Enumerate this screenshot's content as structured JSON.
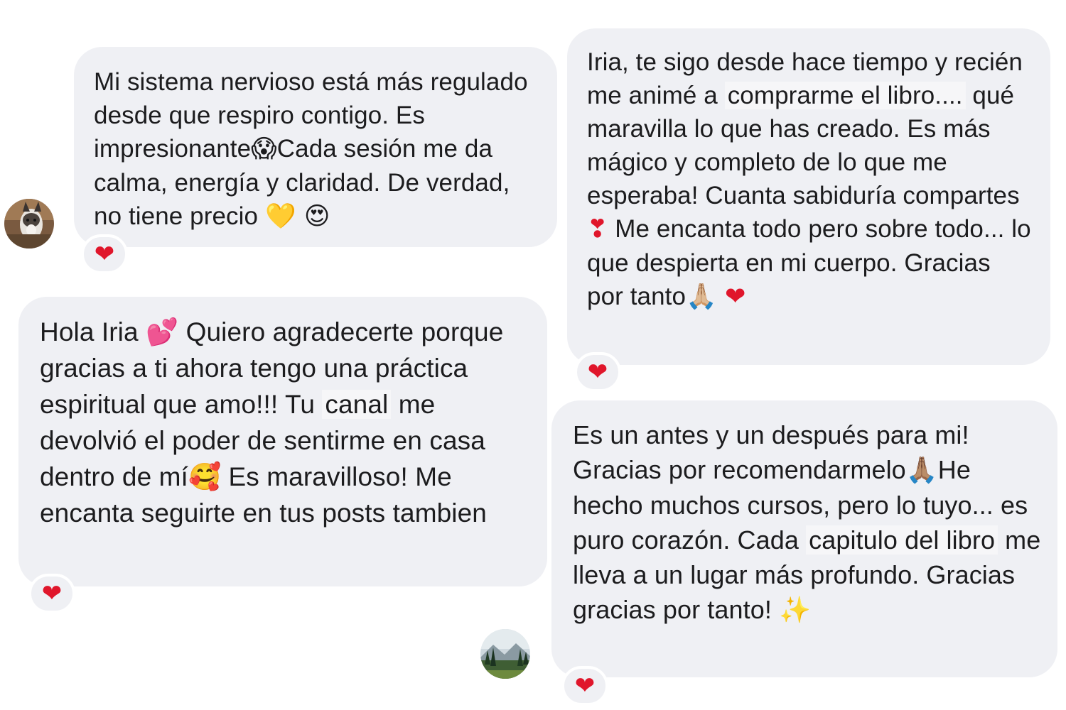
{
  "messages": [
    {
      "text_before": "Mi sistema nervioso está más regulado desde que respiro contigo. Es impresionante",
      "emoji_1": "😱",
      "text_after": "Cada sesión me da calma, energía y claridad. De verdad, no tiene precio ",
      "emoji_2": "💛 😍",
      "reaction": "❤"
    },
    {
      "text_before": "Iria, te sigo desde hace tiempo y recién me animé a ",
      "highlight": "comprarme el libro....",
      "text_after": " qué maravilla lo que has creado. Es más mágico y completo de lo que me esperaba! Cuanta sabiduría compartes ",
      "emoji_1": "❣",
      "text_after_2": " Me encanta todo pero sobre todo... lo que despierta en mi cuerpo. Gracias por tanto",
      "emoji_2": "🙏🏼 ❤",
      "reaction": "❤"
    },
    {
      "text_before": "Hola Iria ",
      "emoji_1": "💕",
      "text_after": " Quiero agradecerte porque gracias a ti ahora tengo una práctica espiritual que amo!!! Tu ",
      "highlight": "canal",
      "text_after_2": " me devolvió el poder de sentirme en casa dentro de mí",
      "emoji_2": "🥰",
      "text_after_3": " Es maravilloso! Me encanta seguirte en tus posts tambien",
      "reaction": "❤"
    },
    {
      "text_before": "Es un antes y un después para mi! Gracias por recomendarmelo",
      "emoji_1": "🙏🏽",
      "text_after": "He hecho muchos cursos, pero lo tuyo... es puro corazón. Cada ",
      "highlight": "capitulo del libro",
      "text_after_2": " me lleva a un lugar más profundo. Gracias gracias por tanto! ",
      "emoji_2": "✨",
      "reaction": "❤"
    }
  ],
  "avatars": {
    "first": "dog-photo-avatar",
    "second": "landscape-photo-avatar"
  },
  "colors": {
    "bubble": "#eff0f4",
    "text": "#1c1c1e",
    "heart": "#e0162b"
  }
}
